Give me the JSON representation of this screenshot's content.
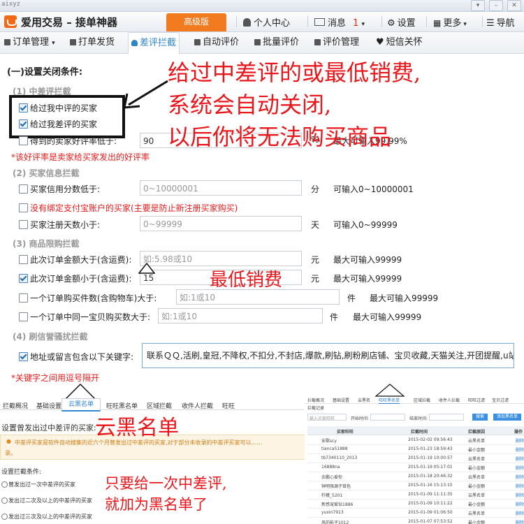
{
  "chrome": {
    "user": "aixyz"
  },
  "titlebar": {
    "app_title": "爱用交易 – 接单神器",
    "vip_label": "高级版",
    "personal_center": "个人中心",
    "messages": "消息",
    "messages_count": "1",
    "settings": "设置",
    "more": "更多",
    "nav_cut": "导航"
  },
  "nav": {
    "items": [
      "订单管理",
      "打单发货",
      "差评拦截",
      "自动评价",
      "批量评价",
      "评价管理",
      "短信关怀"
    ],
    "active_index": 2
  },
  "form": {
    "heading": "(一)设置关闭条件:",
    "sec1": "(1) 中差评拦截",
    "rule_midreview": "给过我中评的买家",
    "rule_badreview": "给过我差评的买家",
    "rule_goodrate": "得到的卖家好评率低于:",
    "goodrate_value": "90",
    "goodrate_unit": "%",
    "goodrate_hint": "最大可输入99.99%",
    "goodrate_note": "*该好评率是卖家给买家发出的好评率",
    "sec2": "(2) 买家信息拦截",
    "credit_label": "买家信用分数低于:",
    "credit_placeholder": "0~10000001",
    "credit_unit": "分",
    "credit_hint": "可输入0~10000001",
    "alipay_label": "没有绑定支付宝账户的买家(主要是防止新注册买家购买)",
    "regdays_label": "买家注册天数小于:",
    "regdays_placeholder": "0~99999",
    "regdays_unit": "天",
    "regdays_hint": "可输入0~99999",
    "sec3": "(3) 商品限购拦截",
    "amount_gt_label": "此次订单金额大于(含运费):",
    "amount_gt_placeholder": "如:5.98或10",
    "amount_unit": "元",
    "amount_hint": "最大可输入99999",
    "amount_lt_label": "此次订单金额小于(含运费):",
    "amount_lt_value": "15",
    "qty_label": "一个订单购买件数(含购物车)大于:",
    "qty_placeholder": "如:1或10",
    "qty_unit": "件",
    "qty_hint": "最大可输入99999",
    "same_label": "一个订单中同一宝贝购买数大于:",
    "same_placeholder": "如:1或10",
    "sec4": "(4) 刷信誉骚扰拦截",
    "kw_label": "地址或留言包含以下关键字:",
    "kw_value": "联系ＱＱ,活刷,皇冠,不降权,不扣分,不封店,爆款,刷钻,刷粉刷店铺、宝贝收藏,天猫关注,开团提醒,u站",
    "kw_note": "*关键字之间用逗号隔开"
  },
  "annotations": {
    "main_line1": "给过中差评的或最低销费,",
    "main_line2": "系统会自动关闭,",
    "main_line3": "以后你将无法购买商品",
    "min_spend": "最低销费",
    "blacklist": "云黑名单",
    "once_line1": "只要给一次中差评,",
    "once_line2": "就加为黑名单了"
  },
  "left_shot": {
    "tabs": [
      "拦截概况",
      "基础设置",
      "云黑名单",
      "旺旺黑名单",
      "区域拦截",
      "收件人拦截",
      "旺旺"
    ],
    "active_tab": 2,
    "subtitle": "设置曾发出过中差评的买家:",
    "notice": "中差评买家是软件自动搜集的近六个月曾发出过中差评的买家,对于部分未收录的中差评买家可以……",
    "notice2": "录。",
    "cond_title": "设置拦截条件:",
    "options": [
      "曾发出过一次中差评的买家",
      "发出过二次及以上的中差评的买家",
      "发出过三次及以上的中差评的买家"
    ]
  },
  "right_shot": {
    "tabs": [
      "拦截概况",
      "基础设置",
      "云黑名",
      "旺旺黑名单",
      "区域拦截",
      "收件人拦截",
      "旺旺过滤",
      "宝贝过滤"
    ],
    "sub": "拦截记录",
    "search_placeholder": "输入买家旺旺",
    "start_label": "开始时间:",
    "end_label": "结束时间:",
    "search_btn": "搜索",
    "add_btn": "添加黑名单",
    "columns": [
      "买家旺旺",
      "拦截时间",
      "拦截原因",
      "操作"
    ],
    "rows": [
      [
        "安歌scy",
        "2015-02-02 09:56:43",
        "云黑名单",
        "删除"
      ],
      [
        "tianca51888",
        "2015-01-23 18:59:43",
        "最小金额",
        "删除"
      ],
      [
        "tb7340110_2013",
        "2015-01-19 10:00:57",
        "云黑名单",
        "删除"
      ],
      [
        "16888na",
        "2015-01-19 05:17:01",
        "最小金额",
        "删除"
      ],
      [
        "余鹏心爱你",
        "2015-01-18 20:46:32",
        "云黑名单",
        "删除"
      ],
      [
        "钟明强源子茸色",
        "2015-01-16 15:13:15",
        "最小金额",
        "删除"
      ],
      [
        "柠檬_5201",
        "2015-01-09 11:11:35",
        "云黑名单",
        "删除"
      ],
      [
        "新感宠爱钻1886",
        "2015-01-09 10:11:22",
        "最小金额",
        "删除"
      ],
      [
        "yuxin7913",
        "2015-01-09 01:06:50",
        "云黑名单",
        "删除"
      ],
      [
        "风的影子1012",
        "2015-01-07 07:53:52",
        "最小金额",
        "删除"
      ]
    ]
  }
}
